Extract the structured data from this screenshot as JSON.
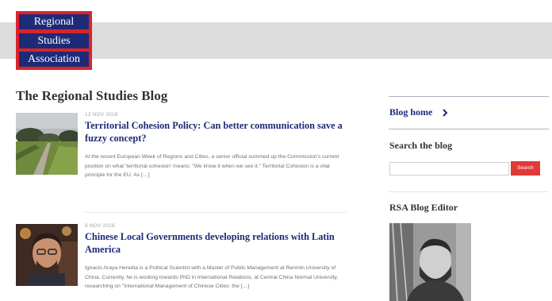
{
  "header": {
    "logo_lines": [
      "Regional",
      "Studies",
      "Association"
    ],
    "colors": {
      "band": "#dcdcdc",
      "logo_red": "#d9232b",
      "logo_navy": "#1d2a77"
    }
  },
  "page": {
    "title": "The Regional Studies Blog"
  },
  "posts": [
    {
      "date": "12 NOV 2018",
      "title": "Territorial Cohesion Policy: Can better communication save a fuzzy concept?",
      "excerpt": "At the recent European Week of Regions and Cities, a senior official summed up the Commission's current position on what 'territorial cohesion' means: \"We know it when we see it.\" Territorial Cohesion is a vital principle for the EU. As […]"
    },
    {
      "date": "8 NOV 2018",
      "title": "Chinese Local Governments developing relations with Latin America",
      "excerpt": "Ignacio Araya Heredia is a Political Scientist with a Master of Public Management at Renmin University of China. Currently, he is working towards PhD in International Relations, at Central China Normal University, researching on \"International Management of Chinese Cities: the […]"
    }
  ],
  "sidebar": {
    "blog_home_label": "Blog home",
    "search_heading": "Search the blog",
    "search_placeholder": "",
    "search_button_label": "Search",
    "editor_heading": "RSA Blog Editor",
    "icons": {
      "blog_home": "chevron-right-icon"
    },
    "colors": {
      "link": "#1d2a77",
      "search_button": "#e03a37"
    }
  }
}
